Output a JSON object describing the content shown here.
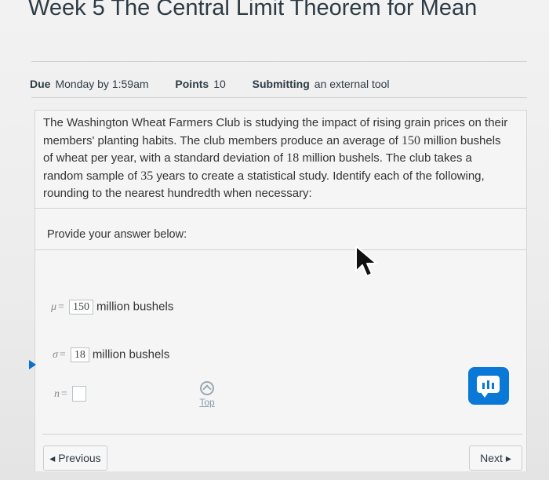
{
  "page": {
    "title": "Week 5 The Central Limit Theorem for Mean"
  },
  "meta": {
    "due_label": "Due",
    "due_value": "Monday by 1:59am",
    "points_label": "Points",
    "points_value": "10",
    "submitting_label": "Submitting",
    "submitting_value": "an external tool"
  },
  "question": {
    "part1": "The Washington Wheat Farmers Club is studying the impact of rising grain prices on their members' planting habits. The club members produce an average of ",
    "num1": "150",
    "part2": " million bushels of wheat per year, with a standard deviation of ",
    "num2": "18",
    "part3": " million bushels. The club takes a random sample of ",
    "num3": "35",
    "part4": " years to create a statistical study. Identify each of the following, rounding to the nearest hundredth when necessary:"
  },
  "provide_label": "Provide your answer below:",
  "answers": [
    {
      "symbol": "μ",
      "value": "150",
      "unit": "million bushels"
    },
    {
      "symbol": "σ",
      "value": "18",
      "unit": "million bushels"
    },
    {
      "symbol": "n",
      "value": "",
      "unit": ""
    }
  ],
  "top_link": "Top",
  "nav": {
    "previous": "◂ Previous",
    "next": "Next ▸"
  },
  "colors": {
    "accent": "#0a78d7",
    "text": "#2d3b45"
  },
  "icons": [
    "chevron-up-icon",
    "chat-icon",
    "cursor-arrow-icon",
    "play-marker-icon"
  ]
}
